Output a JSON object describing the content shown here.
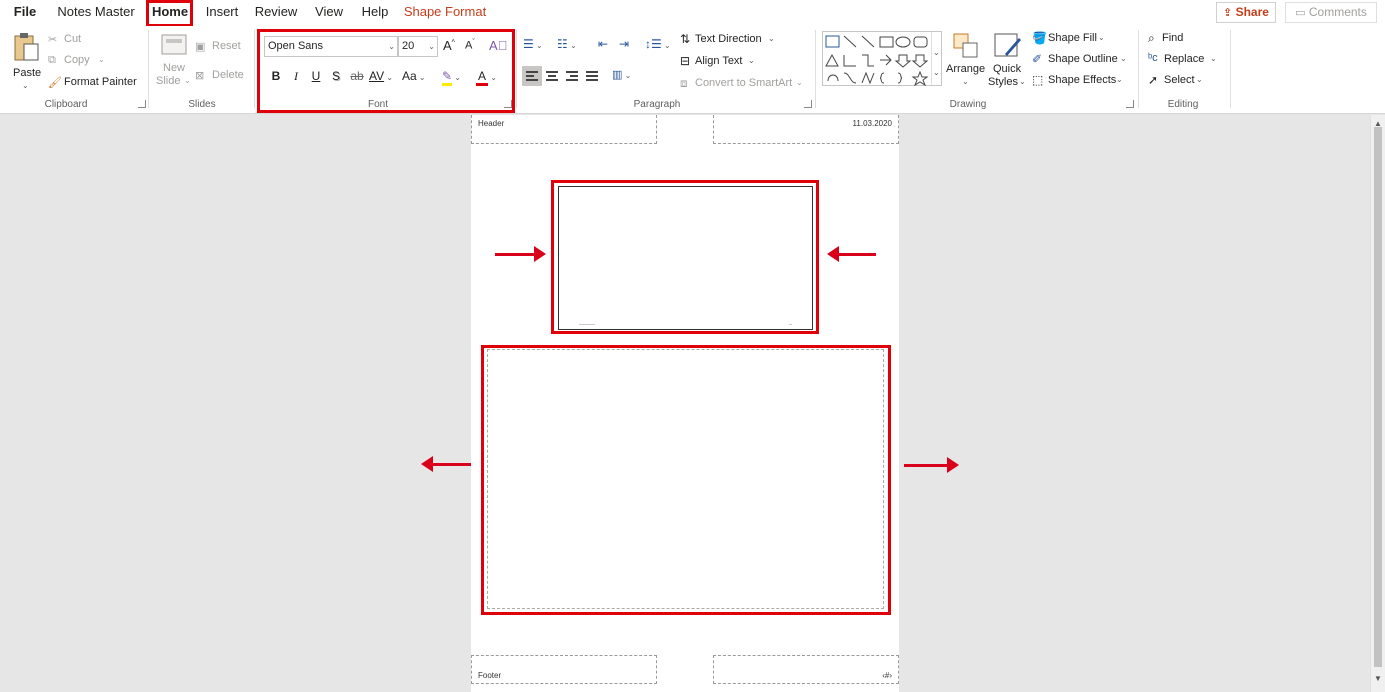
{
  "menu": {
    "tabs": [
      {
        "label": "File"
      },
      {
        "label": "Notes Master"
      },
      {
        "label": "Home"
      },
      {
        "label": "Insert"
      },
      {
        "label": "Review"
      },
      {
        "label": "View"
      },
      {
        "label": "Help"
      },
      {
        "label": "Shape Format"
      }
    ],
    "share_label": "Share",
    "comments_label": "Comments"
  },
  "ribbon": {
    "clipboard": {
      "paste": "Paste",
      "cut": "Cut",
      "copy": "Copy",
      "format_painter": "Format Painter",
      "label": "Clipboard"
    },
    "slides": {
      "new_slide_line1": "New",
      "new_slide_line2": "Slide",
      "reset": "Reset",
      "delete": "Delete",
      "label": "Slides"
    },
    "font": {
      "font_name": "Open Sans",
      "font_size": "20",
      "grow": "A",
      "shrink": "A",
      "bold": "B",
      "italic": "I",
      "underline": "U",
      "shadow": "S",
      "strike": "ab",
      "spacing": "AV",
      "case": "Aa",
      "font_color": "A",
      "label": "Font"
    },
    "paragraph": {
      "text_direction": "Text Direction",
      "align_text": "Align Text",
      "convert_smartart": "Convert to SmartArt",
      "label": "Paragraph"
    },
    "drawing": {
      "arrange": "Arrange",
      "quick_line1": "Quick",
      "quick_line2": "Styles",
      "shape_fill": "Shape Fill",
      "shape_outline": "Shape Outline",
      "shape_effects": "Shape Effects",
      "label": "Drawing"
    },
    "editing": {
      "find": "Find",
      "replace": "Replace",
      "select": "Select",
      "label": "Editing"
    }
  },
  "page": {
    "header": "Header",
    "date": "11.03.2020",
    "footer": "Footer",
    "page_number": "‹#›"
  },
  "colors": {
    "accent": "#c43e1c",
    "highlight": "#e0000a"
  }
}
